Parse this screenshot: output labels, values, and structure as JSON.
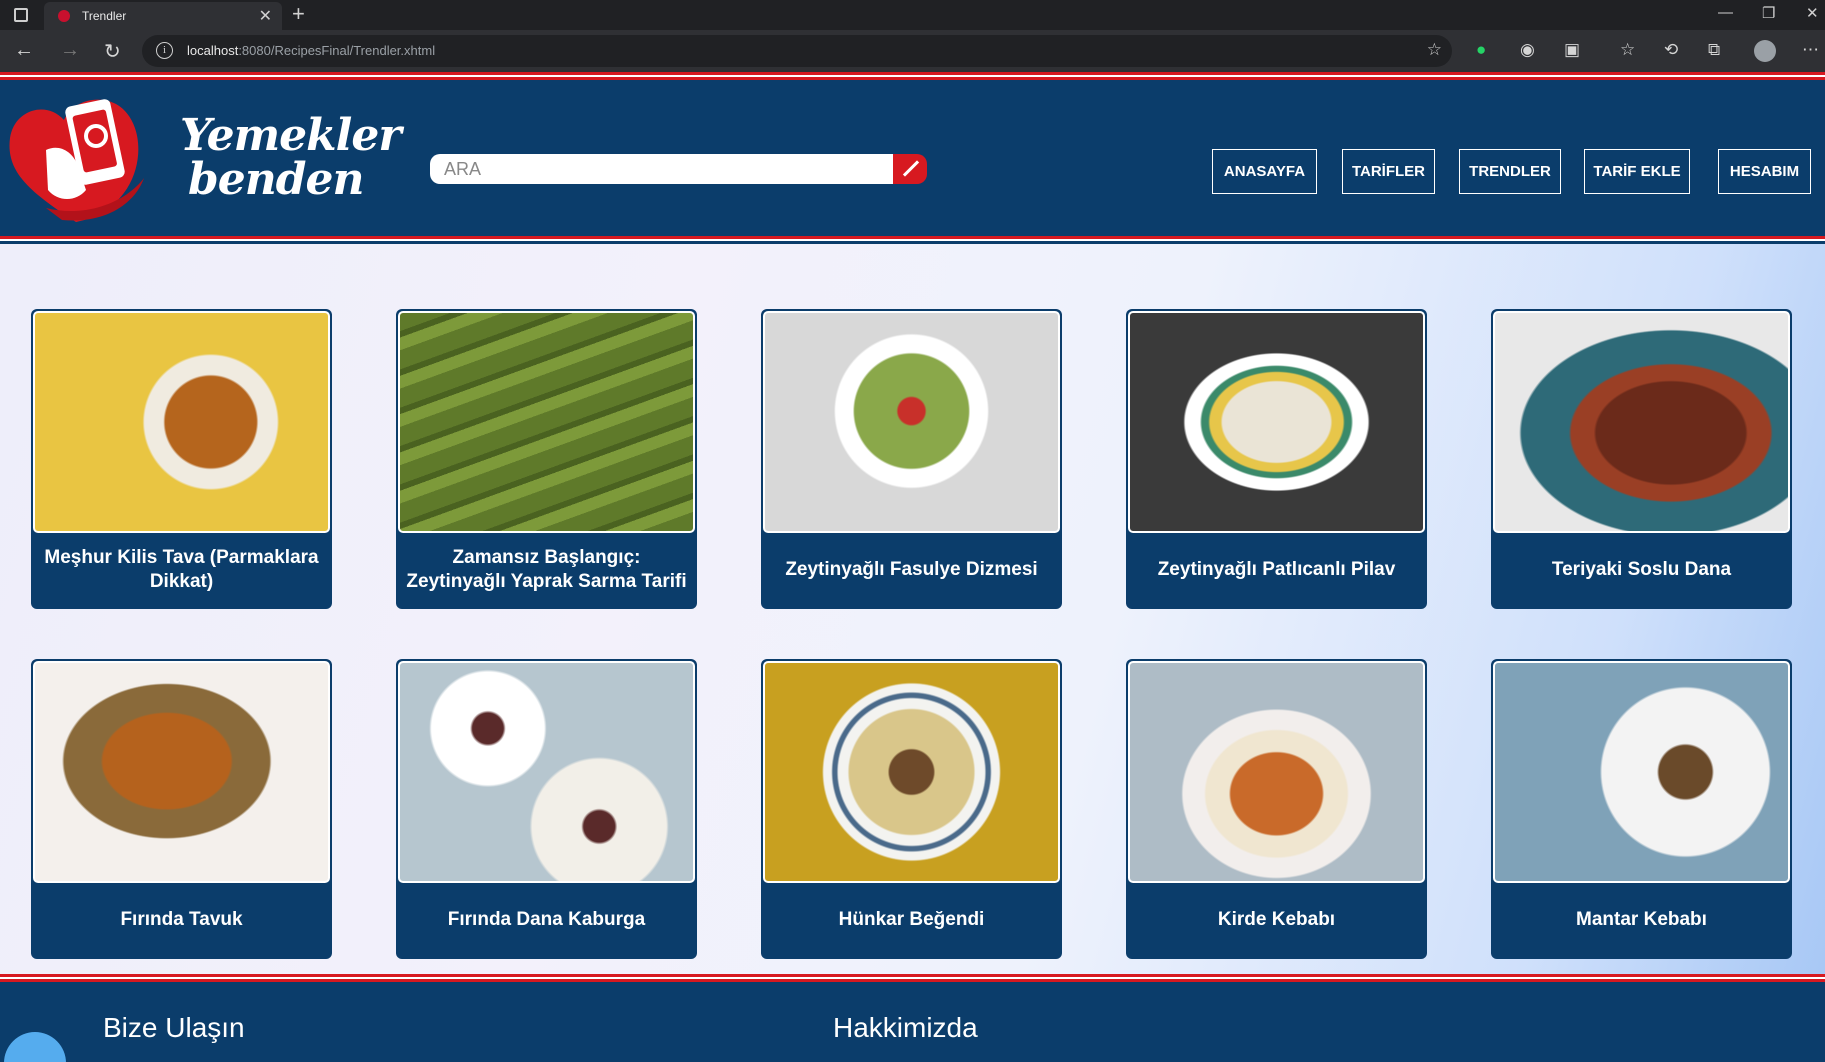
{
  "browser": {
    "tab_title": "Trendler",
    "url_host": "localhost",
    "url_path": ":8080/RecipesFinal/Trendler.xhtml"
  },
  "brand": {
    "line1": "Yemekler",
    "line2": "benden"
  },
  "search": {
    "placeholder": "ARA"
  },
  "nav": [
    {
      "label": "ANASAYFA"
    },
    {
      "label": "TARİFLER"
    },
    {
      "label": "TRENDLER"
    },
    {
      "label": "TARİF EKLE"
    },
    {
      "label": "HESABIM"
    }
  ],
  "recipes": [
    {
      "title": "Meşhur Kilis Tava (Parmaklara Dikkat)"
    },
    {
      "title": "Zamansız Başlangıç: Zeytinyağlı Yaprak Sarma Tarifi"
    },
    {
      "title": "Zeytinyağlı Fasulye Dizmesi"
    },
    {
      "title": "Zeytinyağlı Patlıcanlı Pilav"
    },
    {
      "title": "Teriyaki Soslu Dana"
    },
    {
      "title": "Fırında Tavuk"
    },
    {
      "title": "Fırında Dana Kaburga"
    },
    {
      "title": "Hünkar Beğendi"
    },
    {
      "title": "Kirde Kebabı"
    },
    {
      "title": "Mantar Kebabı"
    }
  ],
  "footer": {
    "contact_heading": "Bize Ulaşın",
    "about_heading": "Hakkimizda"
  },
  "colors": {
    "primary": "#0b3d6b",
    "accent": "#d71920"
  }
}
